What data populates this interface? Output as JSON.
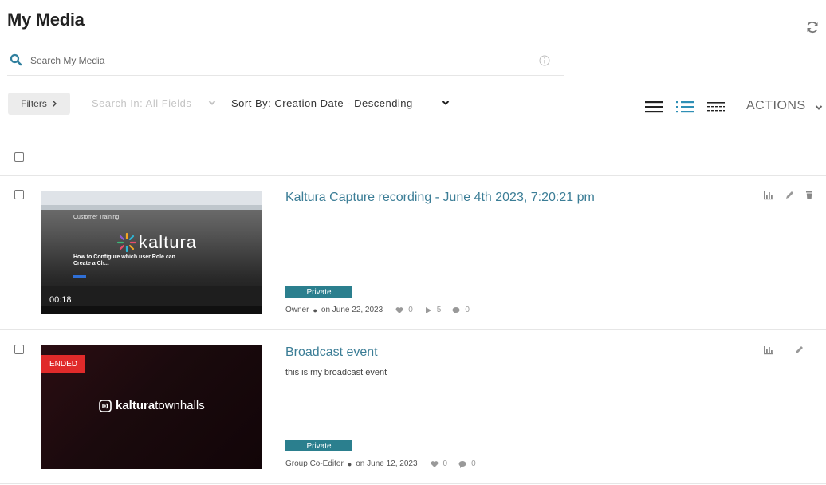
{
  "page": {
    "title": "My Media"
  },
  "search": {
    "placeholder": "Search My Media"
  },
  "toolbar": {
    "filters_label": "Filters",
    "search_in_label": "Search In: All Fields",
    "sort_label": "Sort By: Creation Date - Descending",
    "actions_label": "ACTIONS"
  },
  "media": [
    {
      "title": "Kaltura Capture recording - June 4th 2023, 7:20:21 pm",
      "description": "",
      "badge": "Private",
      "role": "Owner",
      "date": "on June 22, 2023",
      "likes": "0",
      "plays": "5",
      "comments": "0",
      "duration": "00:18",
      "thumb_heading": "Customer Training",
      "thumb_logo": "kaltura",
      "thumb_caption": "How to Configure which user Role can Create a Ch..."
    },
    {
      "title": "Broadcast event",
      "description": "this is my broadcast event",
      "badge": "Private",
      "role": "Group Co-Editor",
      "date": "on June 12, 2023",
      "likes": "0",
      "comments": "0",
      "status": "ENDED",
      "thumb_logo_bold": "kaltura",
      "thumb_logo_light": "townhalls"
    }
  ],
  "colors": {
    "accent": "#3b7d96",
    "badge": "#2b7f8e",
    "ended": "#e02a2a"
  }
}
